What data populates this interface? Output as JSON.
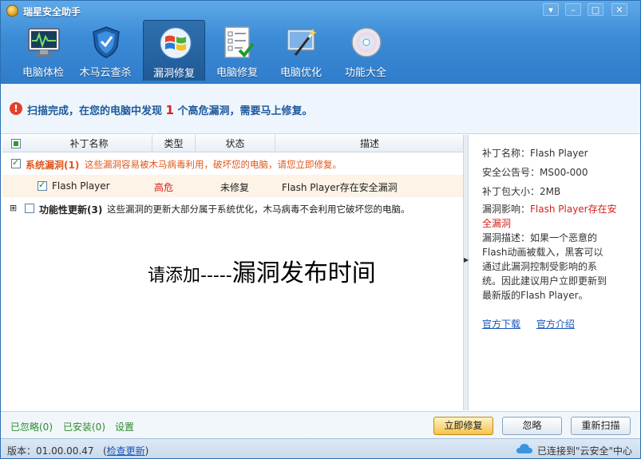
{
  "app": {
    "title": "瑞星安全助手"
  },
  "window_buttons": {
    "menu": "▾",
    "minimize": "–",
    "maximize": "□",
    "close": "✕"
  },
  "toolbar": {
    "items": [
      {
        "label": "电脑体检",
        "icon": "monitor-pulse-icon"
      },
      {
        "label": "木马云查杀",
        "icon": "shield-icon"
      },
      {
        "label": "漏洞修复",
        "icon": "windows-logo-icon",
        "active": true
      },
      {
        "label": "电脑修复",
        "icon": "checklist-icon"
      },
      {
        "label": "电脑优化",
        "icon": "magic-wand-icon"
      },
      {
        "label": "功能大全",
        "icon": "disc-icon"
      }
    ]
  },
  "alert": {
    "icon": "!",
    "text_before": "扫描完成，在您的电脑中发现",
    "count": "1",
    "text_after": "个高危漏洞，需要马上修复。"
  },
  "table": {
    "columns": [
      "补丁名称",
      "类型",
      "状态",
      "描述"
    ],
    "groups": [
      {
        "title": "系统漏洞(1)",
        "note": "这些漏洞容易被木马病毒利用，破坏您的电脑，请您立即修复。",
        "items": [
          {
            "name": "Flash Player",
            "type": "高危",
            "status": "未修复",
            "desc": "Flash Player存在安全漏洞"
          }
        ]
      },
      {
        "expander": "⊞",
        "title": "功能性更新(3)",
        "note": "这些漏洞的更新大部分属于系统优化，木马病毒不会利用它破坏您的电脑。"
      }
    ]
  },
  "placeholder": {
    "prefix": "请添加-----",
    "main": "漏洞发布时间"
  },
  "detail": {
    "name_label": "补丁名称：",
    "name": "Flash Player",
    "bulletin_label": "安全公告号：",
    "bulletin": "MS00-000",
    "size_label": "补丁包大小：",
    "size": "2MB",
    "impact_label": "漏洞影响：",
    "impact": "Flash Player存在安全漏洞",
    "desc_label": "漏洞描述：",
    "desc": "如果一个恶意的Flash动画被载入，黑客可以通过此漏洞控制受影响的系统。因此建议用户立即更新到最新版的Flash Player。",
    "link_download": "官方下载",
    "link_intro": "官方介绍"
  },
  "bottom": {
    "ignored": "已忽略(0)",
    "installed": "已安装(0)",
    "settings": "设置",
    "fix_now": "立即修复",
    "ignore": "忽略",
    "rescan": "重新扫描"
  },
  "status": {
    "version_label": "版本：01.00.00.47",
    "check_update": "检查更新",
    "connection": "已连接到\"云安全\"中心"
  },
  "colors": {
    "accent": "#2f7ccb",
    "danger": "#d4211b",
    "group": "#e0571c",
    "link": "#1a56b8",
    "ok": "#2e8b2e"
  }
}
